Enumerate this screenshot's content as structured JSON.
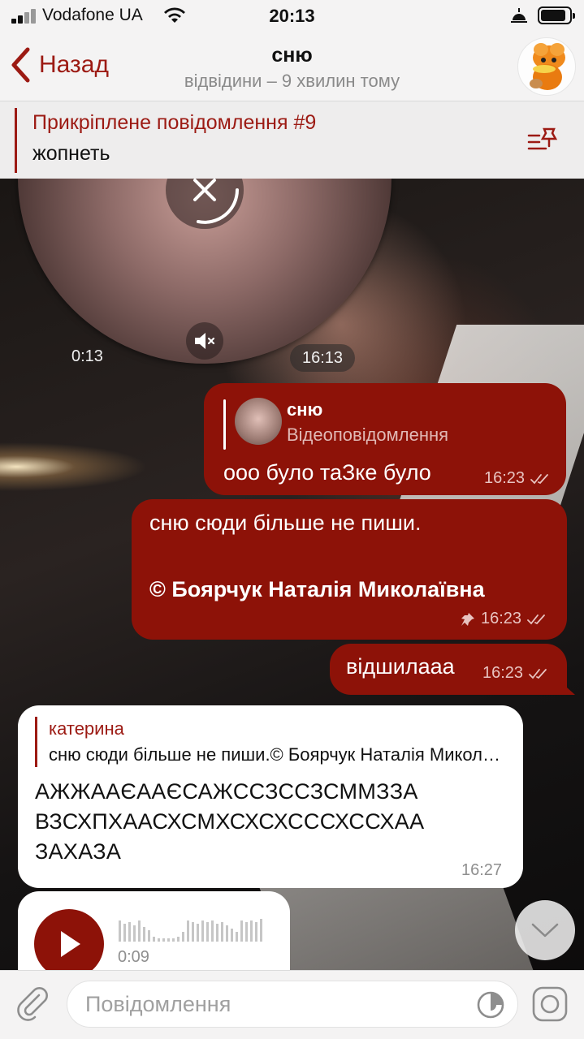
{
  "status_bar": {
    "carrier": "Vodafone UA",
    "time": "20:13"
  },
  "header": {
    "back_label": "Назад",
    "title": "сню",
    "subtitle": "відвідини – 9 хвилин тому"
  },
  "pinned": {
    "title": "Прикріплене повідомлення #9",
    "text": "жопнеть"
  },
  "video_note": {
    "duration": "0:13",
    "time": "16:13"
  },
  "messages": [
    {
      "direction": "outgoing",
      "reply_name": "сню",
      "reply_text": "Відеоповідомлення",
      "text": "ооо було таЗке було",
      "time": "16:23"
    },
    {
      "direction": "outgoing",
      "line1": "сню сюди більше не пиши.",
      "line2": "© Боярчук Наталія Миколаївна",
      "time": "16:23",
      "pinned": true
    },
    {
      "direction": "outgoing",
      "text": "відшилааа",
      "time": "16:23"
    },
    {
      "direction": "incoming",
      "reply_name": "катерина",
      "reply_text": "сню сюди більше не пиши.© Боярчук Наталія Миколаївна",
      "line1": "АЖЖААЄААЄСАЖССЗССЗСММЗЗА",
      "line2": "ВЗСХПХААСХСМХСХСХСССХССХАА",
      "line3": "ЗАХАЗА",
      "time": "16:27"
    },
    {
      "direction": "incoming",
      "type": "voice",
      "duration": "0:09"
    }
  ],
  "input": {
    "placeholder": "Повідомлення"
  },
  "colors": {
    "accent": "#9c1a13",
    "outgoing_bubble": "#8d1208",
    "incoming_bubble": "#ffffff"
  }
}
